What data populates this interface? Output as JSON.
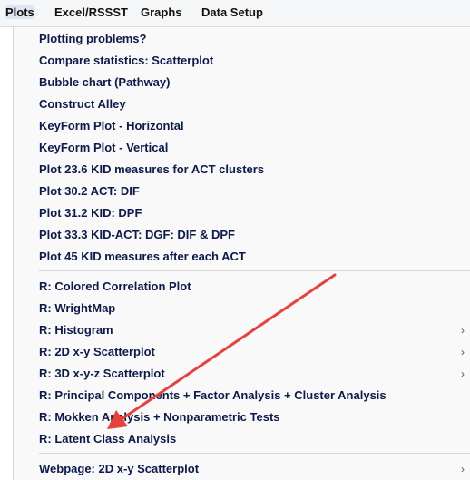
{
  "menubar": {
    "items": [
      "Plots",
      "Excel/RSSST",
      "Graphs",
      "Data Setup"
    ]
  },
  "dropdown": {
    "group1": [
      "Plotting problems?",
      "Compare statistics: Scatterplot",
      "Bubble chart (Pathway)",
      "Construct Alley",
      "KeyForm Plot - Horizontal",
      "KeyForm Plot - Vertical",
      "Plot 23.6 KID measures for ACT clusters",
      "Plot 30.2 ACT: DIF",
      "Plot 31.2 KID: DPF",
      "Plot 33.3 KID-ACT: DGF: DIF & DPF",
      "Plot 45 KID measures after each ACT"
    ],
    "group2": [
      "R: Colored Correlation Plot",
      "R: WrightMap",
      "R: Histogram",
      "R: 2D x-y Scatterplot",
      "R: 3D x-y-z Scatterplot",
      "R: Principal Components + Factor Analysis + Cluster Analysis",
      "R: Mokken Analysis + Nonparametric Tests",
      "R: Latent Class Analysis"
    ],
    "group3": [
      "Webpage: 2D x-y Scatterplot"
    ],
    "submenu_chevron": "›"
  },
  "annotation": {
    "arrow_color": "#e8403a"
  }
}
